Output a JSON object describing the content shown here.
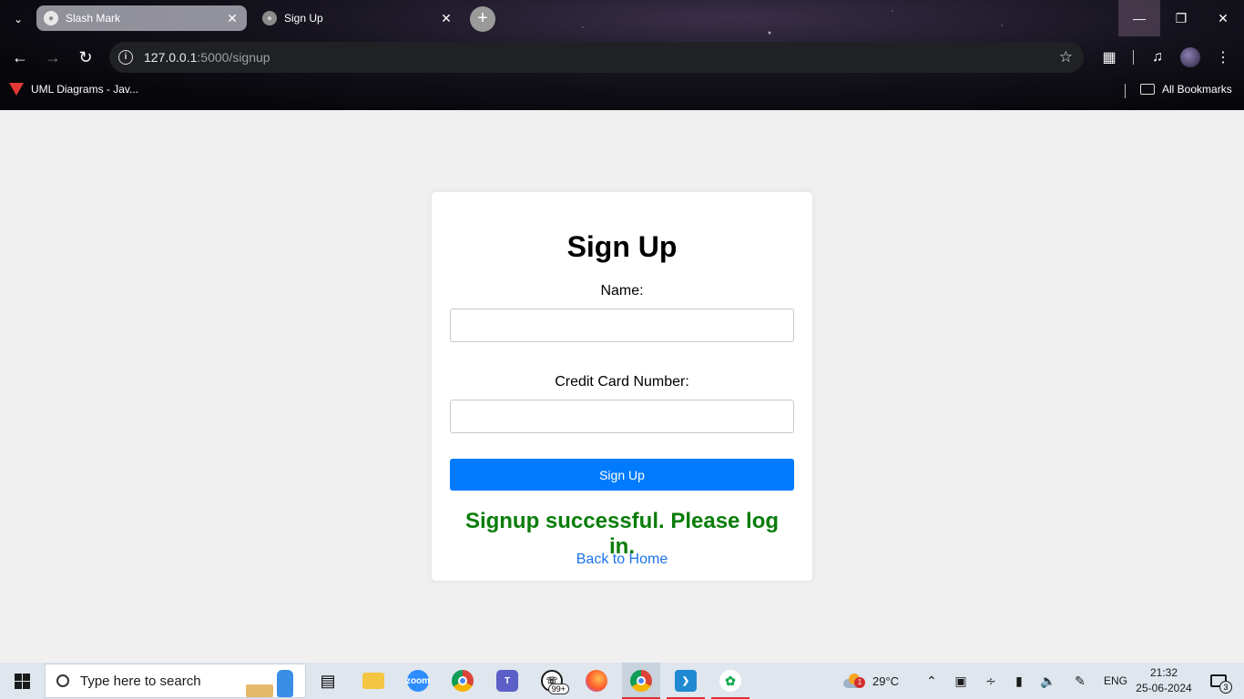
{
  "browser": {
    "tabs": [
      {
        "title": "Slash Mark",
        "active": true
      },
      {
        "title": "Sign Up",
        "active": false
      }
    ],
    "address": {
      "host": "127.0.0.1",
      "path": ":5000/signup"
    },
    "bookmarks": [
      {
        "label": "UML Diagrams - Jav..."
      }
    ],
    "all_bookmarks_label": "All Bookmarks"
  },
  "page": {
    "heading": "Sign Up",
    "name_label": "Name:",
    "card_label": "Credit Card Number:",
    "name_value": "",
    "card_value": "",
    "submit_label": "Sign Up",
    "success_message": "Signup successful. Please log in.",
    "home_link": "Back to Home"
  },
  "taskbar": {
    "search_placeholder": "Type here to search",
    "whatsapp_badge": "99+",
    "weather_badge": "1",
    "temperature": "29°C",
    "language": "ENG",
    "time": "21:32",
    "date": "25-06-2024",
    "notification_count": "3"
  },
  "colors": {
    "primary_button": "#007bff",
    "success_text": "#0a7d0a",
    "link": "#1a73e8",
    "page_background": "#f0f0f0"
  }
}
